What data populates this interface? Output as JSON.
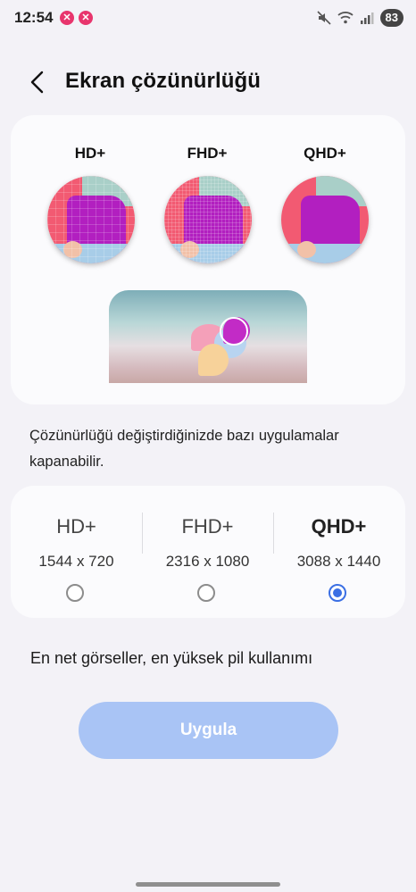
{
  "status_bar": {
    "time": "12:54",
    "battery": "83",
    "notifications": [
      "notification-app-icon",
      "notification-app-icon"
    ],
    "icons": [
      "mute-icon",
      "wifi-icon",
      "signal-icon"
    ]
  },
  "header": {
    "title": "Ekran çözünürlüğü",
    "back_icon": "chevron-left-icon"
  },
  "preview": {
    "labels": [
      "HD+",
      "FHD+",
      "QHD+"
    ]
  },
  "notice": "Çözünürlüğü değiştirdiğinizde bazı uygulamalar kapanabilir.",
  "options": [
    {
      "name": "HD+",
      "resolution": "1544 x 720",
      "selected": false
    },
    {
      "name": "FHD+",
      "resolution": "2316 x 1080",
      "selected": false
    },
    {
      "name": "QHD+",
      "resolution": "3088 x 1440",
      "selected": true
    }
  ],
  "description": "En net görseller, en yüksek pil kullanımı",
  "apply_label": "Uygula",
  "colors": {
    "accent": "#3b6fe4",
    "button": "#a9c4f5",
    "background": "#f3f2f7"
  }
}
